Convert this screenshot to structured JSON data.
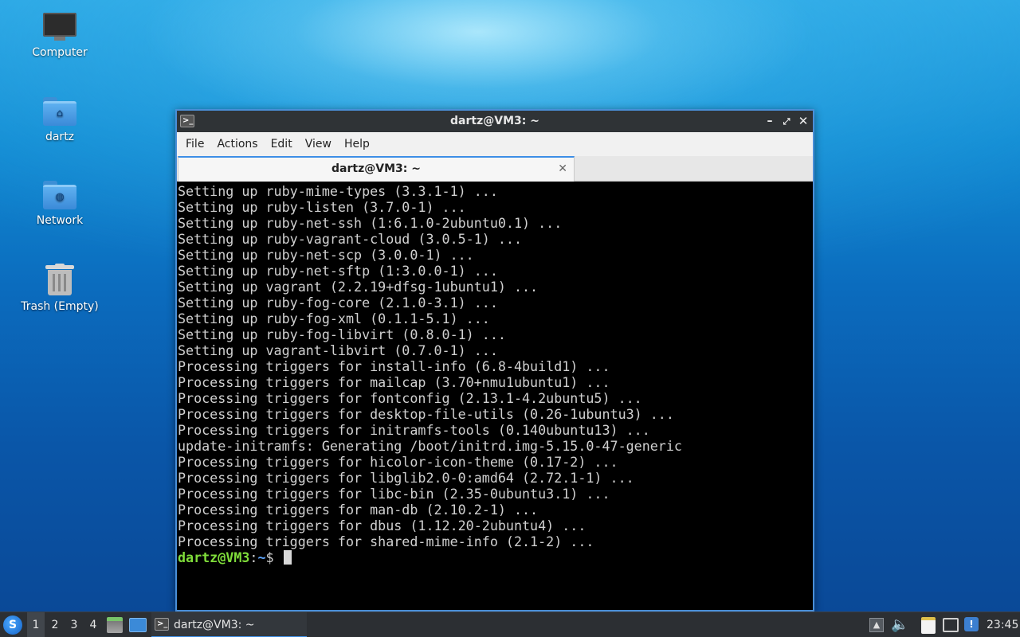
{
  "desktop": {
    "icons": [
      {
        "label": "Computer",
        "icon": "computer-icon"
      },
      {
        "label": "dartz",
        "icon": "home-folder-icon"
      },
      {
        "label": "Network",
        "icon": "network-folder-icon"
      },
      {
        "label": "Trash (Empty)",
        "icon": "trash-icon"
      }
    ]
  },
  "window": {
    "title": "dartz@VM3: ~",
    "menu": [
      "File",
      "Actions",
      "Edit",
      "View",
      "Help"
    ],
    "tab": {
      "label": "dartz@VM3: ~",
      "close_glyph": "✕"
    },
    "terminal": {
      "lines": [
        "Setting up ruby-mime-types (3.3.1-1) ...",
        "Setting up ruby-listen (3.7.0-1) ...",
        "Setting up ruby-net-ssh (1:6.1.0-2ubuntu0.1) ...",
        "Setting up ruby-vagrant-cloud (3.0.5-1) ...",
        "Setting up ruby-net-scp (3.0.0-1) ...",
        "Setting up ruby-net-sftp (1:3.0.0-1) ...",
        "Setting up vagrant (2.2.19+dfsg-1ubuntu1) ...",
        "Setting up ruby-fog-core (2.1.0-3.1) ...",
        "Setting up ruby-fog-xml (0.1.1-5.1) ...",
        "Setting up ruby-fog-libvirt (0.8.0-1) ...",
        "Setting up vagrant-libvirt (0.7.0-1) ...",
        "Processing triggers for install-info (6.8-4build1) ...",
        "Processing triggers for mailcap (3.70+nmu1ubuntu1) ...",
        "Processing triggers for fontconfig (2.13.1-4.2ubuntu5) ...",
        "Processing triggers for desktop-file-utils (0.26-1ubuntu3) ...",
        "Processing triggers for initramfs-tools (0.140ubuntu13) ...",
        "update-initramfs: Generating /boot/initrd.img-5.15.0-47-generic",
        "Processing triggers for hicolor-icon-theme (0.17-2) ...",
        "Processing triggers for libglib2.0-0:amd64 (2.72.1-1) ...",
        "Processing triggers for libc-bin (2.35-0ubuntu3.1) ...",
        "Processing triggers for man-db (2.10.2-1) ...",
        "Processing triggers for dbus (1.12.20-2ubuntu4) ...",
        "Processing triggers for shared-mime-info (2.1-2) ..."
      ],
      "prompt": {
        "user_host": "dartz@VM3",
        "separator": ":",
        "path": "~",
        "symbol": "$ "
      }
    }
  },
  "taskbar": {
    "workspaces": [
      "1",
      "2",
      "3",
      "4"
    ],
    "active_workspace": "1",
    "task_label": "dartz@VM3: ~",
    "clock": "23:45"
  }
}
